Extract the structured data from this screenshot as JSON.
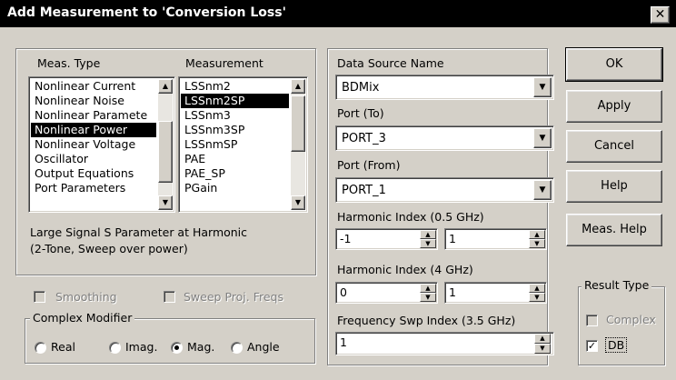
{
  "window": {
    "title": "Add Measurement to 'Conversion Loss'",
    "close_glyph": "✕"
  },
  "left_panel": {
    "meas_type_header": "Meas. Type",
    "measurement_header": "Measurement",
    "meas_types": [
      "Nonlinear Current",
      "Nonlinear Noise",
      "Nonlinear Paramete",
      "Nonlinear Power",
      "Nonlinear Voltage",
      "Oscillator",
      "Output Equations",
      "Port Parameters"
    ],
    "meas_type_selected": "Nonlinear Power",
    "measurements": [
      "LSSnm2",
      "LSSnm2SP",
      "LSSnm3",
      "LSSnm3SP",
      "LSSnmSP",
      "PAE",
      "PAE_SP",
      "PGain"
    ],
    "measurement_selected": "LSSnm2SP",
    "description_line1": "Large Signal S Parameter at Harmonic",
    "description_line2": "(2-Tone, Sweep over power)",
    "smoothing_label": "Smoothing",
    "smoothing_checked": false,
    "sweep_proj_freqs_label": "Sweep Proj. Freqs",
    "sweep_proj_freqs_checked": false,
    "complex_modifier": {
      "legend": "Complex Modifier",
      "options": [
        "Real",
        "Imag.",
        "Mag.",
        "Angle"
      ],
      "selected": "Mag."
    }
  },
  "middle_panel": {
    "data_source_label": "Data Source Name",
    "data_source_value": "BDMix",
    "port_to_label": "Port (To)",
    "port_to_value": "PORT_3",
    "port_from_label": "Port (From)",
    "port_from_value": "PORT_1",
    "harmonic1_label": "Harmonic Index (0.5 GHz)",
    "harmonic1_a": "-1",
    "harmonic1_b": "1",
    "harmonic2_label": "Harmonic Index (4 GHz)",
    "harmonic2_a": "0",
    "harmonic2_b": "1",
    "freq_swp_label": "Frequency Swp Index (3.5 GHz)",
    "freq_swp_value": "1"
  },
  "buttons": {
    "ok": "OK",
    "apply": "Apply",
    "cancel": "Cancel",
    "help": "Help",
    "meas_help": "Meas. Help"
  },
  "result_type": {
    "legend": "Result Type",
    "complex_label": "Complex",
    "complex_checked": false,
    "db_label": "DB",
    "db_checked": true,
    "check_glyph": "✓"
  },
  "icons": {
    "up": "▲",
    "down": "▼"
  },
  "colors": {
    "face": "#d4d0c8",
    "title_bar": "#000000",
    "selection": "#000000"
  }
}
